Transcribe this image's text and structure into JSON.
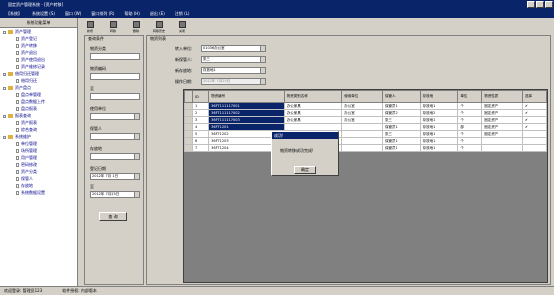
{
  "title_bar": {
    "title": "固定资产管理系统 - [资产转移]"
  },
  "menu": [
    "【系统】",
    "系统设置 (S)",
    "窗口 (W)",
    "窗口排列 (R)",
    "帮助 (H)",
    "退出 (E)",
    "注销 (L)"
  ],
  "toolbar": {
    "buttons": [
      {
        "label": "新增",
        "icon": "add-icon"
      },
      {
        "label": "转移",
        "icon": "transfer-icon"
      },
      {
        "label": "删除",
        "icon": "delete-icon"
      },
      {
        "label": "转移历史",
        "icon": "history-icon"
      },
      {
        "label": "关闭",
        "icon": "close-icon"
      }
    ]
  },
  "sidebar": {
    "header": "系统功能菜单",
    "items": [
      {
        "label": "资产管理",
        "type": "group"
      },
      {
        "label": "资产登记",
        "type": "child"
      },
      {
        "label": "资产转移",
        "type": "child"
      },
      {
        "label": "资产退出",
        "type": "child"
      },
      {
        "label": "资产使用退出",
        "type": "child"
      },
      {
        "label": "资产维修记录",
        "type": "child"
      },
      {
        "label": "借用归还管理",
        "type": "group"
      },
      {
        "label": "借用归还",
        "type": "child"
      },
      {
        "label": "资产盘点",
        "type": "group"
      },
      {
        "label": "盘点单管理",
        "type": "child"
      },
      {
        "label": "盘点数据上传",
        "type": "child"
      },
      {
        "label": "盘点报表",
        "type": "child"
      },
      {
        "label": "报表查询",
        "type": "group"
      },
      {
        "label": "资产报表",
        "type": "child"
      },
      {
        "label": "综合查询",
        "type": "child"
      },
      {
        "label": "系统维护",
        "type": "group"
      },
      {
        "label": "单位管理",
        "type": "child"
      },
      {
        "label": "场所管理",
        "type": "child"
      },
      {
        "label": "用户管理",
        "type": "child"
      },
      {
        "label": "密码修改",
        "type": "child"
      },
      {
        "label": "资产分类",
        "type": "child"
      },
      {
        "label": "保管人",
        "type": "child"
      },
      {
        "label": "存放地",
        "type": "child"
      },
      {
        "label": "系统数据设置",
        "type": "child"
      }
    ]
  },
  "query_panel": {
    "title": "查询条件",
    "fields": [
      {
        "label": "物资分类",
        "value": ""
      },
      {
        "label": "物资编码",
        "value": ""
      },
      {
        "label": "至",
        "value": ""
      },
      {
        "label": "使用单位",
        "value": ""
      },
      {
        "label": "保管人",
        "value": ""
      },
      {
        "label": "存放地",
        "value": ""
      },
      {
        "label": "登记日期",
        "value": "2012年 7月 1日"
      },
      {
        "label": "至",
        "value": "2012年 7月25日"
      }
    ],
    "query_button": "查 询"
  },
  "transfer_form": {
    "title": "物资列表",
    "fields": [
      {
        "label": "转入单位:",
        "value": "01036办公室"
      },
      {
        "label": "新保管人:",
        "value": "张三"
      },
      {
        "label": "新存放地:",
        "value": "存放地1"
      },
      {
        "label": "操作日期:",
        "value": "2012年 7月25日"
      }
    ]
  },
  "grid": {
    "columns": [
      "ID",
      "物资编号",
      "物资类别名称",
      "使用单位",
      "保管人",
      "存放地",
      "单位",
      "物资性质",
      "选择"
    ],
    "rows": [
      [
        "1",
        "36FT111117001",
        "办公家具",
        "办公室",
        "保管员1",
        "存放地1",
        "个",
        "固定资产",
        "✔"
      ],
      [
        "2",
        "36FT111117002",
        "办公家具",
        "办公室",
        "保管员2",
        "存放地2",
        "个",
        "固定资产",
        "✔"
      ],
      [
        "3",
        "36FT111117003",
        "办公家具",
        "办公室",
        "张三",
        "存放地1",
        "个",
        "固定资产",
        "✔"
      ],
      [
        "4",
        "36FT1201",
        "",
        "",
        "保管员1",
        "存放地1",
        "部",
        "固定资产",
        "✔"
      ],
      [
        "5",
        "36FT1202",
        "",
        "",
        "张三",
        "存放地1",
        "个",
        "固定资产",
        ""
      ],
      [
        "6",
        "36FT1203",
        "",
        "",
        "保管员1",
        "存放地1",
        "个",
        "",
        ""
      ],
      [
        "7",
        "36FT1204",
        "",
        "",
        "保管员1",
        "存放地1",
        "个",
        "",
        ""
      ]
    ]
  },
  "dialog": {
    "title": "成功!",
    "message": "物资转移成功完成!",
    "ok_label": "确定"
  },
  "status": [
    "欢迎登录: 管理员123",
    "软件授权: 内部版本"
  ]
}
